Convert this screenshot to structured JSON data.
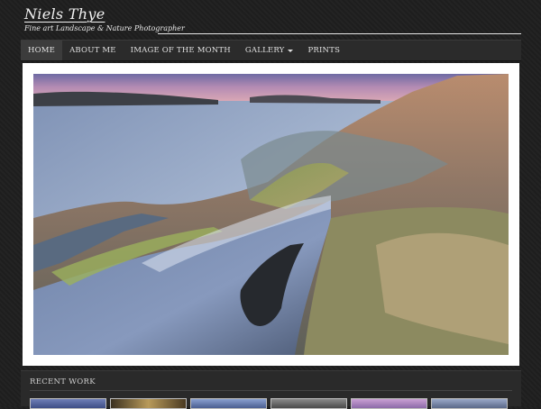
{
  "site": {
    "title": "Niels Thye",
    "tagline": "Fine art Landscape & Nature Photographer"
  },
  "nav": {
    "items": [
      {
        "label": "HOME",
        "active": true
      },
      {
        "label": "ABOUT ME"
      },
      {
        "label": "IMAGE OF THE MONTH"
      },
      {
        "label": "GALLERY",
        "has_dropdown": true
      },
      {
        "label": "PRINTS"
      }
    ]
  },
  "hero": {
    "subject": "coastal rock landscape at dusk"
  },
  "recent": {
    "title": "RECENT WORK",
    "thumb_count": 6
  },
  "colors": {
    "background": "#1f1f1f",
    "nav_bg": "#2b2b2b",
    "nav_active": "#3c3c3c",
    "frame": "#ffffff"
  }
}
